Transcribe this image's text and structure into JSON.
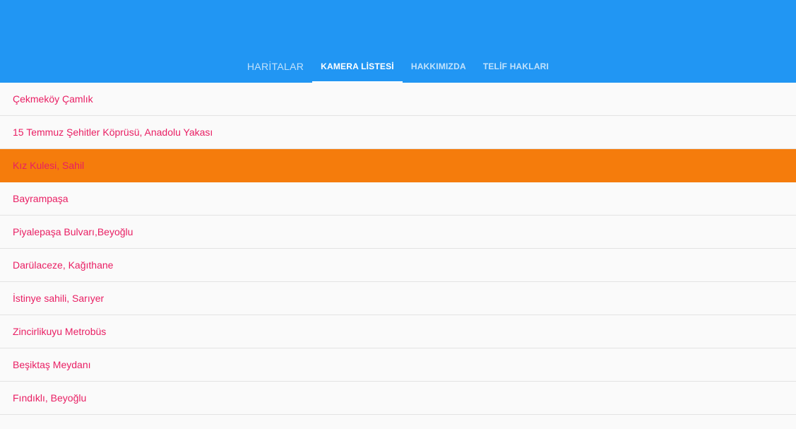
{
  "colors": {
    "appbar": "#2196f3",
    "accent": "#e91e63",
    "selected_row": "#f57c0c",
    "background": "#fafafa"
  },
  "tabs": [
    {
      "label": "HARİTALAR"
    },
    {
      "label": "KAMERA LİSTESİ"
    },
    {
      "label": "HAKKIMIZDA"
    },
    {
      "label": "TELİF HAKLARI"
    }
  ],
  "active_tab": "KAMERA LİSTESİ",
  "cameras": [
    {
      "label": "Çekmeköy Çamlık"
    },
    {
      "label": "15 Temmuz Şehitler Köprüsü, Anadolu Yakası"
    },
    {
      "label": "Kız Kulesi, Sahil"
    },
    {
      "label": "Bayrampaşa"
    },
    {
      "label": "Piyalepaşa Bulvarı,Beyoğlu"
    },
    {
      "label": "Darülaceze, Kağıthane"
    },
    {
      "label": "İstinye sahili, Sarıyer"
    },
    {
      "label": "Zincirlikuyu Metrobüs"
    },
    {
      "label": "Beşiktaş Meydanı"
    },
    {
      "label": "Fındıklı, Beyoğlu"
    }
  ],
  "selected_camera": "Kız Kulesi, Sahil"
}
